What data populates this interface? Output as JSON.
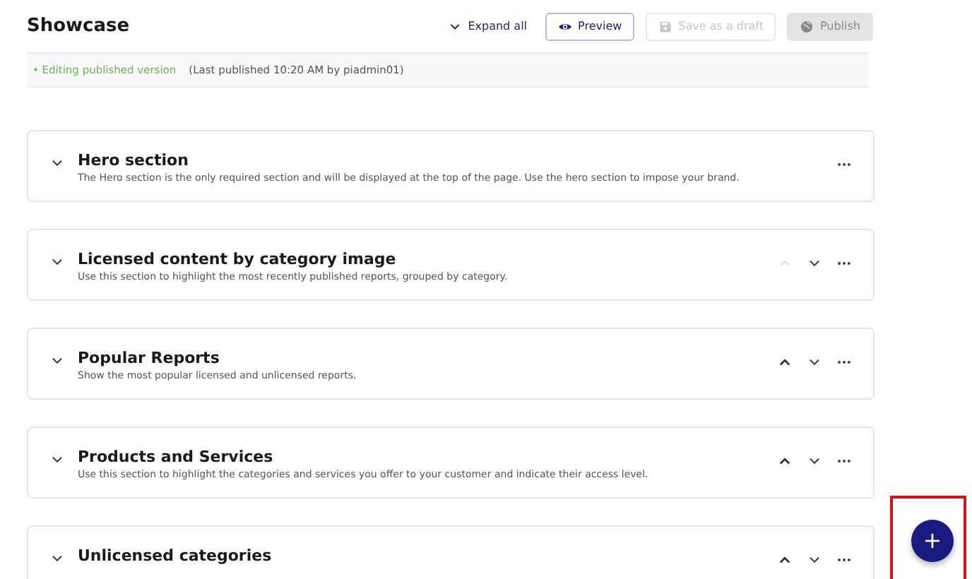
{
  "page": {
    "title": "Showcase"
  },
  "toolbar": {
    "expand_all": "Expand all",
    "preview": "Preview",
    "save_draft": {
      "label": "Save as a draft",
      "disabled": true
    },
    "publish": {
      "label": "Publish",
      "disabled": true
    }
  },
  "status": {
    "state": "• Editing published version",
    "detail": "(Last published 10:20 AM by piadmin01)"
  },
  "sections": [
    {
      "title": "Hero section",
      "description": "The Hero section is the only required section and will be displayed at the top of the page. Use the hero section to impose your brand.",
      "movable": false
    },
    {
      "title": "Licensed content by category image",
      "description": "Use this section to highlight the most recently published reports, grouped by category.",
      "movable": true,
      "up_disabled": true
    },
    {
      "title": "Popular Reports",
      "description": "Show the most popular licensed and unlicensed reports.",
      "movable": true,
      "up_disabled": false
    },
    {
      "title": "Products and Services",
      "description": "Use this section to highlight the categories and services you offer to your customer and indicate their access level.",
      "movable": true,
      "up_disabled": false
    },
    {
      "title": "Unlicensed categories",
      "movable": true,
      "up_disabled": false
    }
  ],
  "fab": {
    "label": "+",
    "highlighted": true
  }
}
